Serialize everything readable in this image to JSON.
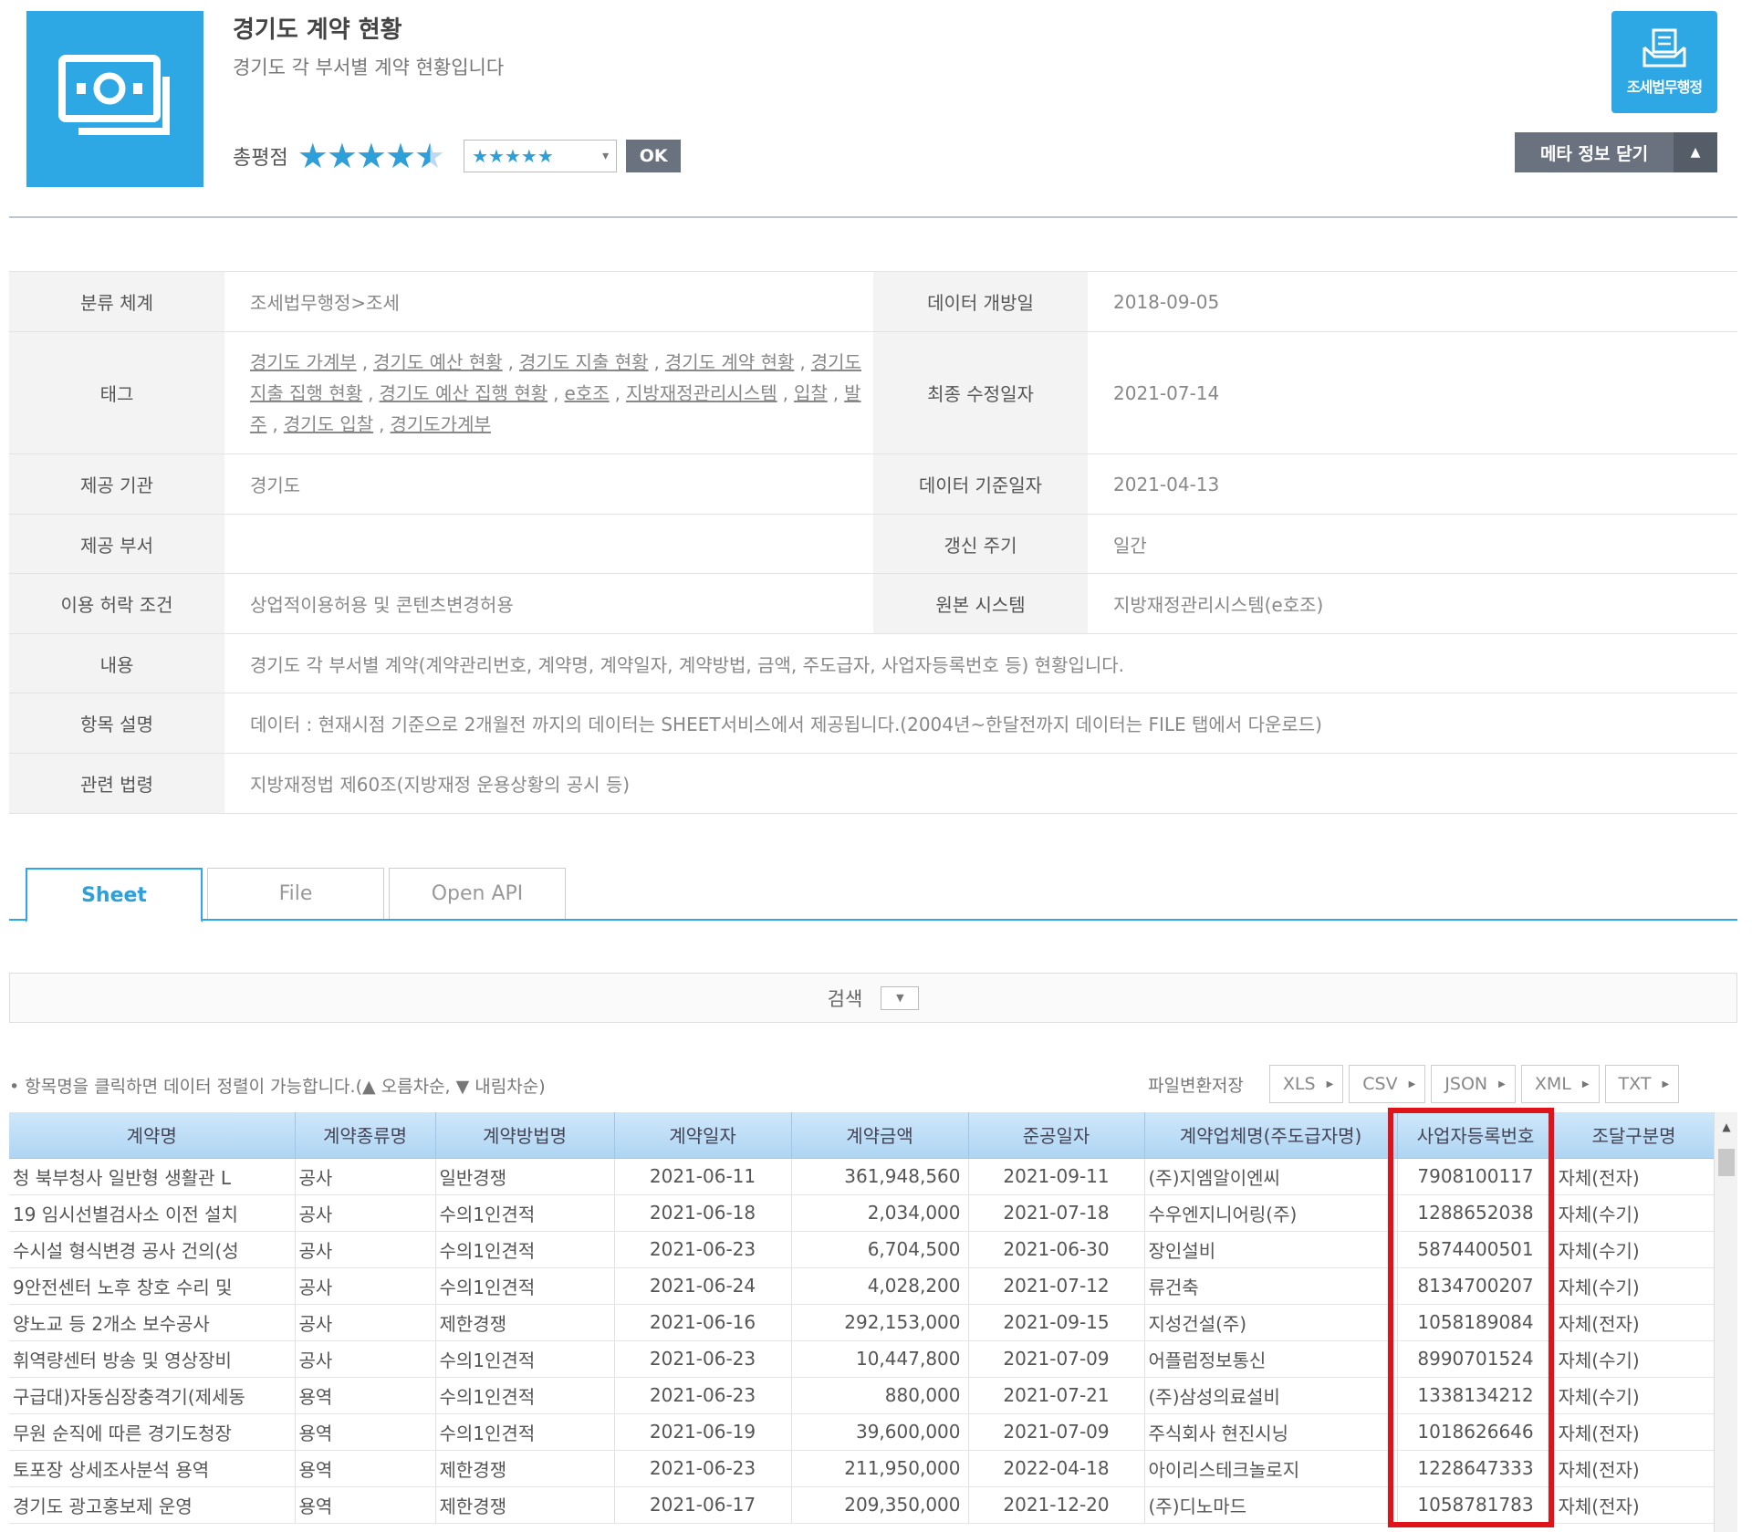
{
  "header": {
    "title": "경기도 계약 현황",
    "subtitle": "경기도 각 부서별 계약 현황입니다",
    "rating_label": "총평점",
    "rating_value": 4.5,
    "rating_stars": "★★★★★",
    "rating_select": "★★★★★",
    "ok_label": "OK",
    "dept_button_label": "조세법무행정",
    "meta_toggle_label": "메타 정보 닫기",
    "accent_color": "#2ea8e5"
  },
  "meta": {
    "classification_label": "분류 체계",
    "classification_value": "조세법무행정>조세",
    "open_date_label": "데이터 개방일",
    "open_date_value": "2018-09-05",
    "tags_label": "태그",
    "tags": [
      "경기도 가계부",
      "경기도 예산 현황",
      "경기도 지출 현황",
      "경기도 계약 현황",
      "경기도 지출 집행 현황",
      "경기도 예산 집행 현황",
      "e호조",
      "지방재정관리시스템",
      "입찰",
      "발주",
      "경기도 입찰",
      "경기도가계부"
    ],
    "modified_label": "최종 수정일자",
    "modified_value": "2021-07-14",
    "provider_label": "제공 기관",
    "provider_value": "경기도",
    "data_date_label": "데이터 기준일자",
    "data_date_value": "2021-04-13",
    "department_label": "제공 부서",
    "department_value": "",
    "cycle_label": "갱신 주기",
    "cycle_value": "일간",
    "license_label": "이용 허락 조건",
    "license_value": "상업적이용허용 및 콘텐츠변경허용",
    "source_label": "원본 시스템",
    "source_value": "지방재정관리시스템(e호조)",
    "content_label": "내용",
    "content_value": "경기도 각 부서별 계약(계약관리번호, 계약명, 계약일자, 계약방법, 금액, 주도급자, 사업자등록번호 등) 현황입니다.",
    "description_label": "항목 설명",
    "description_value": "데이터 : 현재시점 기준으로 2개월전 까지의 데이터는 SHEET서비스에서 제공됩니다.(2004년~한달전까지 데이터는 FILE 탭에서 다운로드)",
    "law_label": "관련 법령",
    "law_value": "지방재정법 제60조(지방재정 운용상황의 공시 등)"
  },
  "tabs": [
    {
      "label": "Sheet",
      "active": true
    },
    {
      "label": "File",
      "active": false
    },
    {
      "label": "Open API",
      "active": false
    }
  ],
  "search": {
    "label": "검색"
  },
  "sort_hint": "• 항목명을 클릭하면 데이터 정렬이 가능합니다.(▲ 오름차순, ▼ 내림차순)",
  "export": {
    "label": "파일변환저장",
    "formats": [
      "XLS",
      "CSV",
      "JSON",
      "XML",
      "TXT"
    ]
  },
  "grid": {
    "columns": [
      "계약명",
      "계약종류명",
      "계약방법명",
      "계약일자",
      "계약금액",
      "준공일자",
      "계약업체명(주도급자명)",
      "사업자등록번호",
      "조달구분명"
    ],
    "rows": [
      [
        "청 북부청사 일반형 생활관 L",
        "공사",
        "일반경쟁",
        "2021-06-11",
        "361,948,560",
        "2021-09-11",
        "(주)지엠알이엔씨",
        "7908100117",
        "자체(전자)"
      ],
      [
        "19 임시선별검사소 이전 설치",
        "공사",
        "수의1인견적",
        "2021-06-18",
        "2,034,000",
        "2021-07-18",
        "수우엔지니어링(주)",
        "1288652038",
        "자체(수기)"
      ],
      [
        "수시설 형식변경 공사 건의(성",
        "공사",
        "수의1인견적",
        "2021-06-23",
        "6,704,500",
        "2021-06-30",
        "장인설비",
        "5874400501",
        "자체(수기)"
      ],
      [
        "9안전센터 노후 창호 수리 및",
        "공사",
        "수의1인견적",
        "2021-06-24",
        "4,028,200",
        "2021-07-12",
        "류건축",
        "8134700207",
        "자체(수기)"
      ],
      [
        " 양노교 등 2개소 보수공사",
        "공사",
        "제한경쟁",
        "2021-06-16",
        "292,153,000",
        "2021-09-15",
        "지성건설(주)",
        "1058189084",
        "자체(전자)"
      ],
      [
        "휘역량센터 방송 및 영상장비",
        "공사",
        "수의1인견적",
        "2021-06-23",
        "10,447,800",
        "2021-07-09",
        "어플럼정보통신",
        "8990701524",
        "자체(수기)"
      ],
      [
        "구급대)자동심장충격기(제세동",
        "용역",
        "수의1인견적",
        "2021-06-23",
        "880,000",
        "2021-07-21",
        "(주)삼성의료설비",
        "1338134212",
        "자체(수기)"
      ],
      [
        "무원 순직에 따른 경기도청장",
        "용역",
        "수의1인견적",
        "2021-06-19",
        "39,600,000",
        "2021-07-09",
        "주식회사 현진시닝",
        "1018626646",
        "자체(전자)"
      ],
      [
        "토포장 상세조사분석 용역",
        "용역",
        "제한경쟁",
        "2021-06-23",
        "211,950,000",
        "2022-04-18",
        "아이리스테크놀로지",
        "1228647333",
        "자체(전자)"
      ],
      [
        "경기도 광고홍보제 운영",
        "용역",
        "제한경쟁",
        "2021-06-17",
        "209,350,000",
        "2021-12-20",
        "(주)디노마드",
        "1058781783",
        "자체(전자)"
      ]
    ],
    "highlight_color": "#e0131a"
  }
}
